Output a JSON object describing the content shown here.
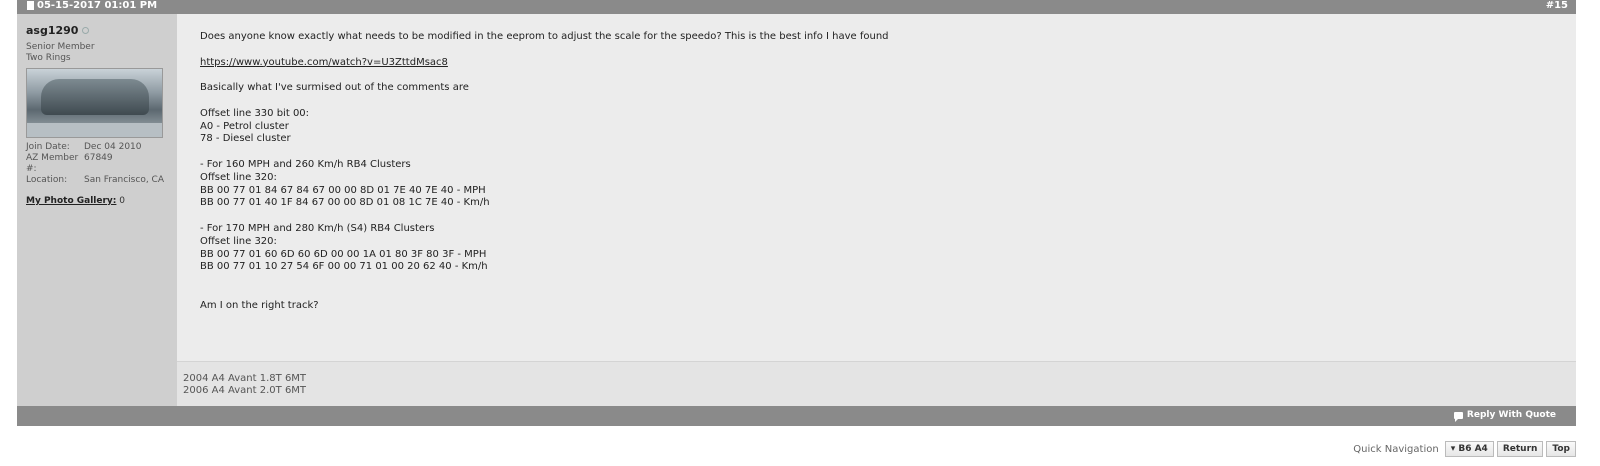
{
  "post": {
    "date": "05-15-2017 01:01 PM",
    "number": "#15",
    "user": {
      "name": "asg1290",
      "title_line1": "Senior Member",
      "title_line2": "Two Rings",
      "join_date_label": "Join Date:",
      "join_date": "Dec 04 2010",
      "member_label": "AZ Member #:",
      "member_no": "67849",
      "location_label": "Location:",
      "location": "San Francisco, CA",
      "gallery_label": "My Photo Gallery:",
      "gallery_count": "0"
    },
    "message": {
      "line1": "Does anyone know exactly what needs to be modified in the eeprom to adjust the scale for the speedo? This is the best info I have found",
      "link": "https://www.youtube.com/watch?v=U3ZttdMsac8",
      "line3": "Basically what I've surmised out of the comments are",
      "block1": "Offset line 330 bit 00:\nA0 - Petrol cluster\n78 - Diesel cluster",
      "block2": "- For 160 MPH and 260 Km/h RB4 Clusters\nOffset line 320:\nBB 00 77 01 84 67 84 67 00 00 8D 01 7E 40 7E 40 - MPH\nBB 00 77 01 40 1F 84 67 00 00 8D 01 08 1C 7E 40 - Km/h",
      "block3": "- For 170 MPH and 280 Km/h (S4) RB4 Clusters\nOffset line 320:\nBB 00 77 01 60 6D 60 6D 00 00 1A 01 80 3F 80 3F - MPH\nBB 00 77 01 10 27 54 6F 00 00 71 01 00 20 62 40 - Km/h",
      "closing": "Am I on the right track?"
    },
    "signature": "2004 A4 Avant 1.8T 6MT\n2006 A4 Avant 2.0T 6MT",
    "reply_label": "Reply With Quote"
  },
  "quicknav": {
    "label": "Quick Navigation",
    "forum_button": "▾ B6 A4",
    "return_button": "Return",
    "top_button": "Top"
  }
}
